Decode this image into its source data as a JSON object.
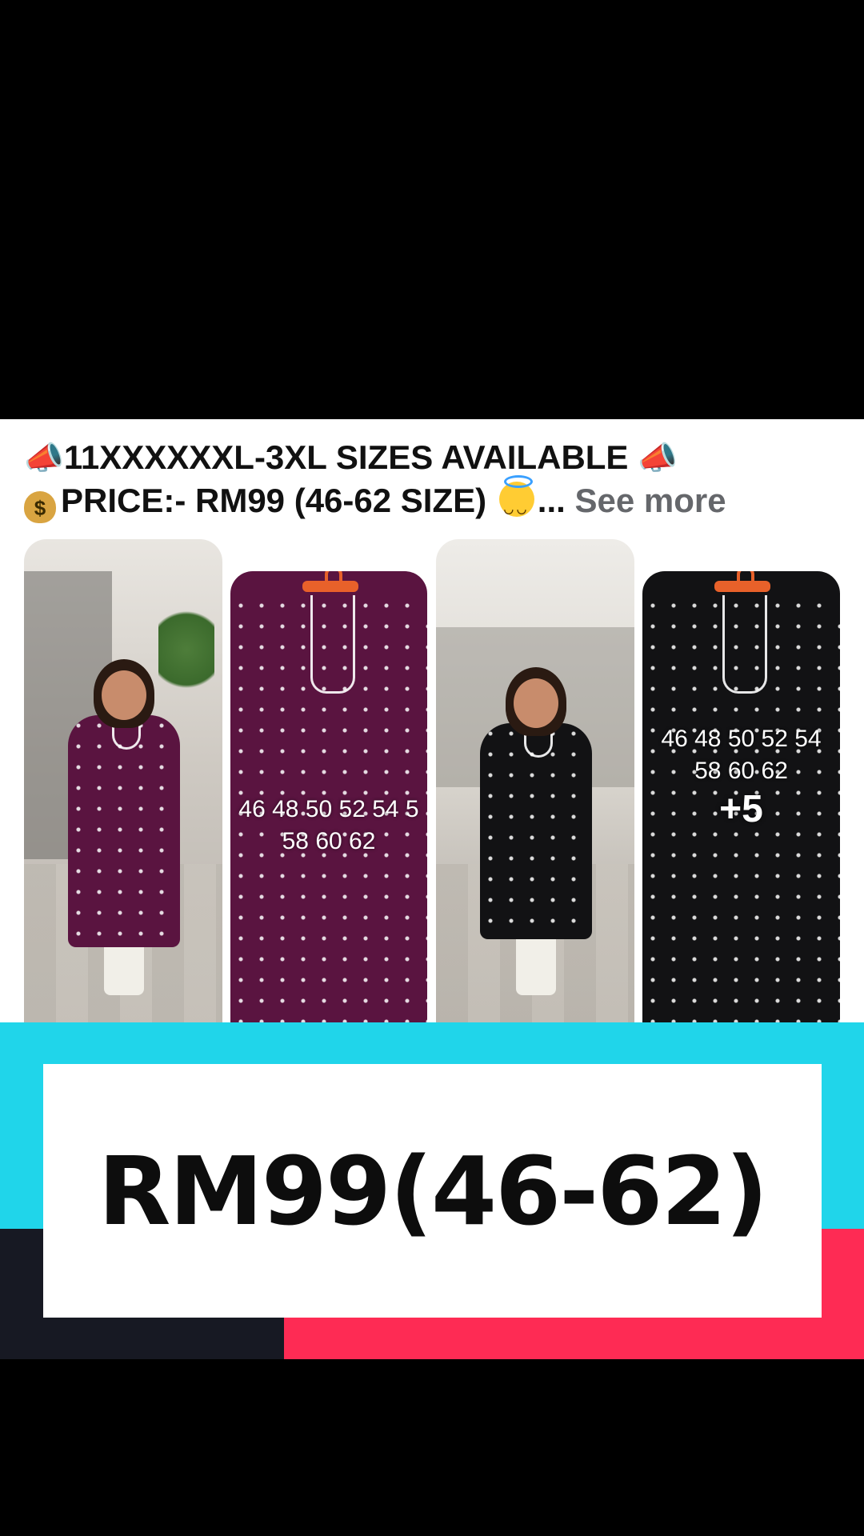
{
  "post": {
    "caption_line1": "11XXXXXXL-3XL SIZES AVAILABLE",
    "caption_line2": "PRICE:- RM99 (46-62 SIZE)",
    "ellipsis": "...",
    "see_more": "See more",
    "icons": [
      "megaphone-icon",
      "money-bag-icon",
      "smiling-halo-emoji-icon"
    ]
  },
  "gallery": {
    "photo2_sizes_line1": "46 48 50 52 54 5",
    "photo2_sizes_line2": "58 60 62",
    "photo4_sizes_line1": "46 48 50 52 54",
    "photo4_sizes_line2": "58 60 62",
    "more_count": "+5",
    "colors": {
      "purple": "#5a1440",
      "black": "#121214"
    }
  },
  "banner": {
    "price": "RM99(46-62)",
    "colors": {
      "cyan": "#20d5ea",
      "red": "#fe2b54",
      "dark": "#171923"
    }
  }
}
